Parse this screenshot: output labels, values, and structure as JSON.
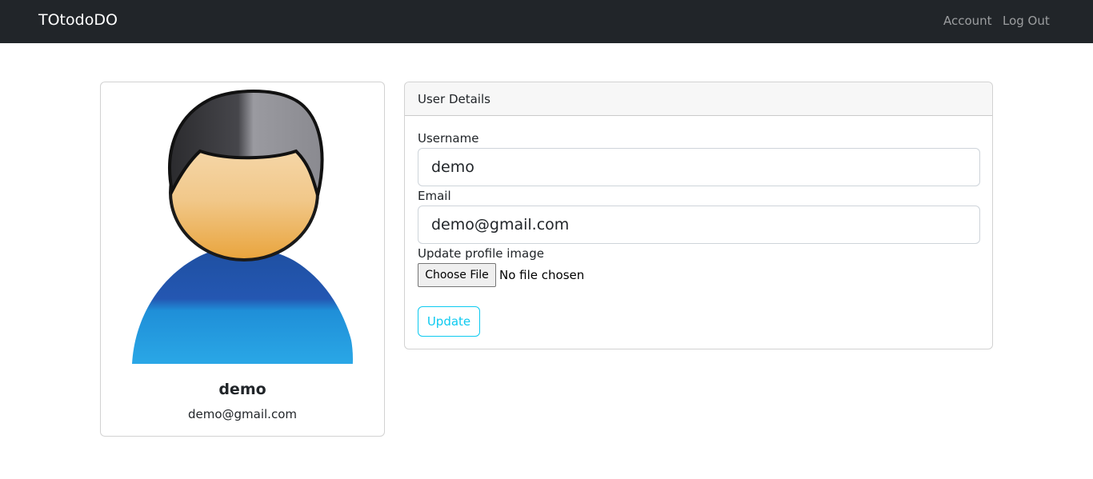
{
  "navbar": {
    "brand": "TOtodoDO",
    "links": [
      "Account",
      "Log Out"
    ]
  },
  "profile": {
    "avatar_icon": "user-avatar-icon",
    "name": "demo",
    "email": "demo@gmail.com"
  },
  "details": {
    "header": "User Details",
    "username_label": "Username",
    "username_value": "demo",
    "email_label": "Email",
    "email_value": "demo@gmail.com",
    "image_label": "Update profile image",
    "file_button": "Choose File",
    "file_status": "No file chosen",
    "update_button": "Update"
  },
  "colors": {
    "navbar_bg": "#212529",
    "accent": "#0dcaf0"
  }
}
